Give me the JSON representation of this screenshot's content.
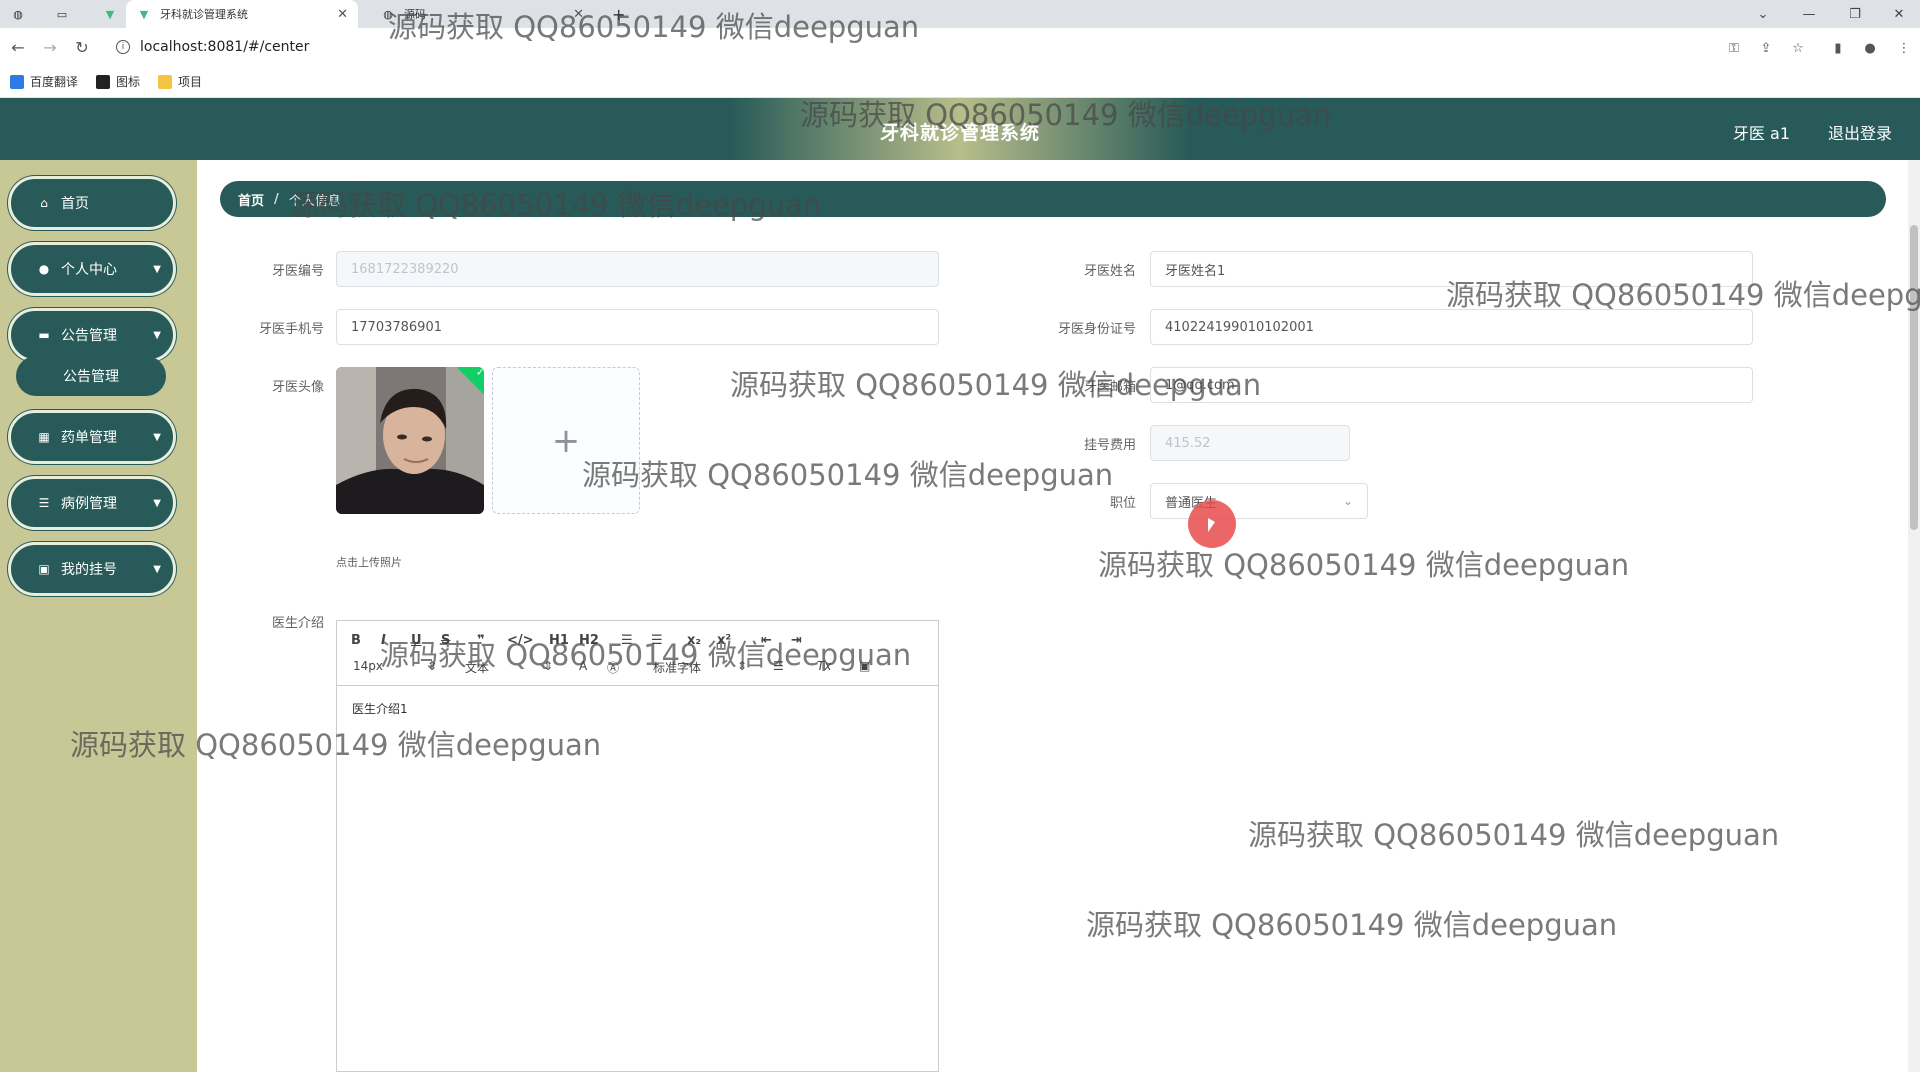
{
  "browser": {
    "tabs": [
      {
        "label": ""
      },
      {
        "label": ""
      },
      {
        "label": ""
      },
      {
        "label": "牙科就诊管理系统",
        "active": true
      },
      {
        "label": "源码"
      }
    ],
    "url": "localhost:8081/#/center",
    "bookmarks": [
      "百度翻译",
      "图标",
      "项目"
    ]
  },
  "header": {
    "title": "牙科就诊管理系统",
    "user": "牙医 a1",
    "logout": "退出登录",
    "colors": {
      "primary": "#275a58",
      "sidebar": "#c8c796"
    }
  },
  "sidebar": {
    "items": [
      {
        "label": "首页",
        "icon": "home-icon"
      },
      {
        "label": "个人中心",
        "icon": "user-icon"
      },
      {
        "label": "公告管理",
        "icon": "monitor-icon"
      },
      {
        "label": "药单管理",
        "icon": "grid-icon"
      },
      {
        "label": "病例管理",
        "icon": "list-icon"
      },
      {
        "label": "我的挂号",
        "icon": "clipboard-icon"
      }
    ],
    "submenu": "公告管理"
  },
  "breadcrumb": {
    "home": "首页",
    "current": "个人信息"
  },
  "form": {
    "dentist_no": {
      "label": "牙医编号",
      "value": "1681722389220"
    },
    "dentist_name": {
      "label": "牙医姓名",
      "value": "牙医姓名1"
    },
    "phone": {
      "label": "牙医手机号",
      "value": "17703786901"
    },
    "id_card": {
      "label": "牙医身份证号",
      "value": "410224199010102001"
    },
    "avatar": {
      "label": "牙医头像",
      "hint": "点击上传照片"
    },
    "email": {
      "label": "牙医邮箱",
      "value": "1@qq.com"
    },
    "fee": {
      "label": "挂号费用",
      "value": "415.52"
    },
    "position": {
      "label": "职位",
      "value": "普通医生"
    },
    "intro": {
      "label": "医生介绍",
      "value": "医生介绍1"
    }
  },
  "editor_toolbar": {
    "font_size": "14px",
    "text_style": "文本",
    "font_family": "标准字体",
    "buttons": [
      "B",
      "I",
      "U",
      "S",
      "❞",
      "</>",
      "H1",
      "H2",
      "☰",
      "☰",
      "x₂",
      "x²",
      "⇤",
      "⇥"
    ]
  },
  "watermark": "源码获取 QQ86050149 微信deepguan"
}
